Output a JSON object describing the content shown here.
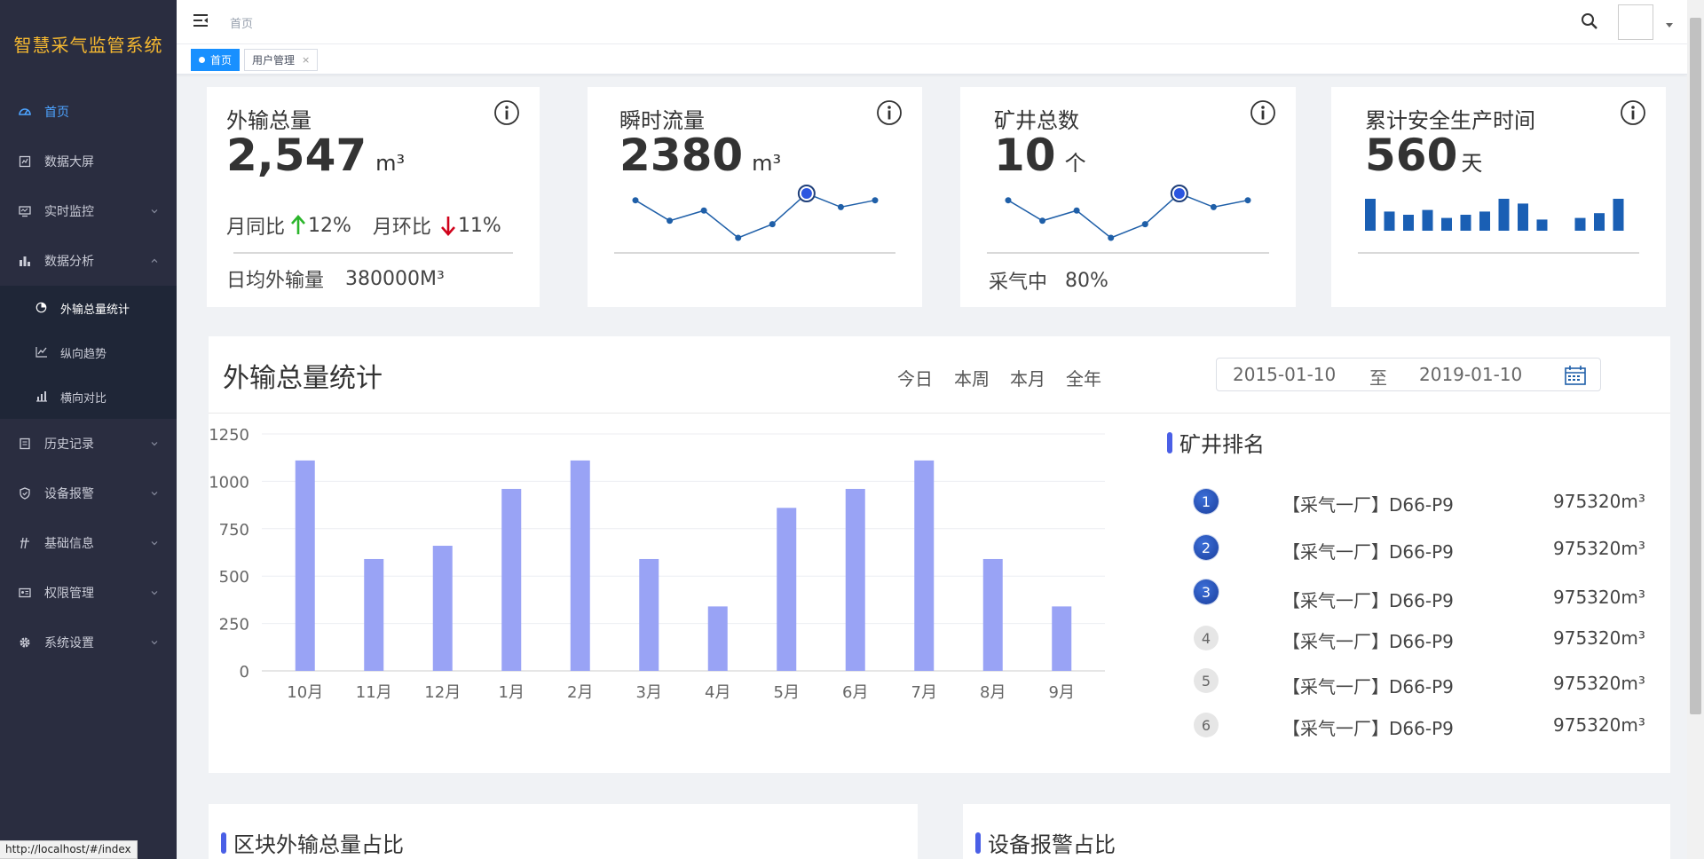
{
  "app": {
    "brand": "智慧采气监管系统"
  },
  "sidebar": {
    "items": [
      {
        "label": "首页",
        "icon": "dashboard-icon"
      },
      {
        "label": "数据大屏",
        "icon": "screen-icon"
      },
      {
        "label": "实时监控",
        "icon": "monitor-icon"
      },
      {
        "label": "数据分析",
        "icon": "bar-chart-icon"
      },
      {
        "label": "历史记录",
        "icon": "history-icon"
      },
      {
        "label": "设备报警",
        "icon": "shield-icon"
      },
      {
        "label": "基础信息",
        "icon": "info-icon"
      },
      {
        "label": "权限管理",
        "icon": "id-card-icon"
      },
      {
        "label": "系统设置",
        "icon": "gear-icon"
      }
    ],
    "submenu": [
      {
        "label": "外输总量统计",
        "icon": "pie-icon"
      },
      {
        "label": "纵向趋势",
        "icon": "line-icon"
      },
      {
        "label": "横向对比",
        "icon": "compare-icon"
      }
    ]
  },
  "topbar": {
    "breadcrumb": "首页"
  },
  "tags": [
    {
      "label": "首页"
    },
    {
      "label": "用户管理",
      "close": "×"
    }
  ],
  "status_url": "http://localhost/#/index",
  "stats": {
    "export_total": {
      "title": "外输总量",
      "value": "2,547",
      "unit": "m³",
      "yoy_label": "月同比",
      "yoy_value": "12%",
      "mom_label": "月环比",
      "mom_value": "11%",
      "daily_label": "日均外输量",
      "daily_value": "380000M³"
    },
    "instant_flow": {
      "title": "瞬时流量",
      "value": "2380",
      "unit": "m³",
      "spark": [
        6,
        3,
        4.5,
        0.5,
        2.5,
        7,
        5,
        6
      ]
    },
    "well_count": {
      "title": "矿井总数",
      "value": "10",
      "unit": "个",
      "spark": [
        6,
        3,
        4.5,
        0.5,
        2.5,
        7,
        5,
        6
      ],
      "status_label": "采气中",
      "status_value": "80%"
    },
    "safe_time": {
      "title": "累计安全生产时间",
      "value": "560",
      "unit": "天",
      "bars": [
        10,
        6,
        5,
        6.5,
        4,
        5,
        6,
        10,
        8.5,
        3.5,
        0,
        4,
        5.5,
        10
      ]
    }
  },
  "main": {
    "title": "外输总量统计",
    "periods": [
      "今日",
      "本周",
      "本月",
      "全年"
    ],
    "date_start": "2015-01-10",
    "date_sep": "至",
    "date_end": "2019-01-10",
    "rank_title": "矿井排名",
    "ranking": [
      {
        "rank": "1",
        "name": "【采气一厂】D66-P9",
        "value": "975320m³"
      },
      {
        "rank": "2",
        "name": "【采气一厂】D66-P9",
        "value": "975320m³"
      },
      {
        "rank": "3",
        "name": "【采气一厂】D66-P9",
        "value": "975320m³"
      },
      {
        "rank": "4",
        "name": "【采气一厂】D66-P9",
        "value": "975320m³"
      },
      {
        "rank": "5",
        "name": "【采气一厂】D66-P9",
        "value": "975320m³"
      },
      {
        "rank": "6",
        "name": "【采气一厂】D66-P9",
        "value": "975320m³"
      }
    ]
  },
  "chart_data": {
    "type": "bar",
    "categories": [
      "10月",
      "11月",
      "12月",
      "1月",
      "2月",
      "3月",
      "4月",
      "5月",
      "6月",
      "7月",
      "8月",
      "9月"
    ],
    "values": [
      1110,
      590,
      660,
      960,
      1110,
      590,
      340,
      860,
      960,
      1110,
      590,
      340
    ],
    "yticks": [
      "0",
      "250",
      "500",
      "750",
      "1000",
      "1250"
    ],
    "ylim": [
      0,
      1250
    ],
    "color": "#99a3f5",
    "grid": true
  },
  "bottom": {
    "left_title": "区块外输总量占比",
    "right_title": "设备报警占比"
  },
  "colors": {
    "accent": "#1890ff",
    "sidebar_bg": "#2a2d40",
    "brand": "#f5b830",
    "up": "#2bb52b",
    "down": "#d0021b",
    "spark": "#1f5fa8",
    "bars_small": "#1a5fb4"
  }
}
